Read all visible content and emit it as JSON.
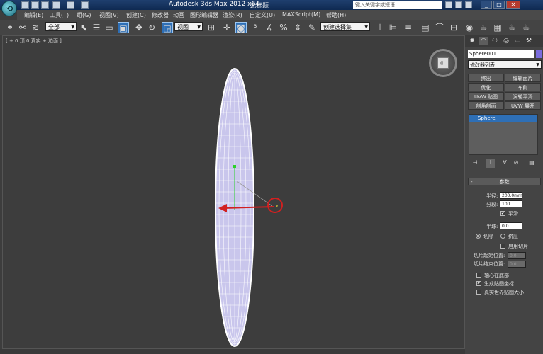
{
  "window": {
    "title": "Autodesk 3ds Max  2012 x64",
    "document": "无标题",
    "search_placeholder": "键入关键字或短语"
  },
  "menu": [
    "编辑(E)",
    "工具(T)",
    "组(G)",
    "视图(V)",
    "创建(C)",
    "修改器",
    "动画",
    "图形编辑器",
    "渲染(R)",
    "自定义(U)",
    "MAXScript(M)",
    "帮助(H)"
  ],
  "toolbar": {
    "filter": "全部",
    "ref_coord": "视图",
    "named_selection": "创建选择集"
  },
  "viewport": {
    "label": "[ + 0 顶 0 真实 + 边面 ]",
    "viewcube_label": "顶"
  },
  "command_panel": {
    "object_name": "Sphere001",
    "object_color": "#7a6cdc",
    "modifier_list": "修改器列表",
    "modifier_buttons": [
      "挤出",
      "编辑面片",
      "优化",
      "车削",
      "UVW 贴图",
      "涡轮平滑",
      "剖角剖面",
      "UVW 展开"
    ],
    "stack_item": "Sphere",
    "params_title": "参数",
    "radius_label": "半径:",
    "radius_value": "200.0mm",
    "segments_label": "分段:",
    "segments_value": "100",
    "smooth_label": "平滑",
    "hemisphere_label": "半球:",
    "hemisphere_value": "0.0",
    "chop_label": "切除",
    "squash_label": "挤压",
    "slice_on_label": "启用切片",
    "slice_from_label": "切片起始位置:",
    "slice_from_value": "0.0",
    "slice_to_label": "切片结束位置:",
    "slice_to_value": "0.0",
    "base_to_pivot_label": "轴心在底部",
    "gen_mapping_label": "生成贴图坐标",
    "real_world_label": "真实世界贴图大小"
  }
}
